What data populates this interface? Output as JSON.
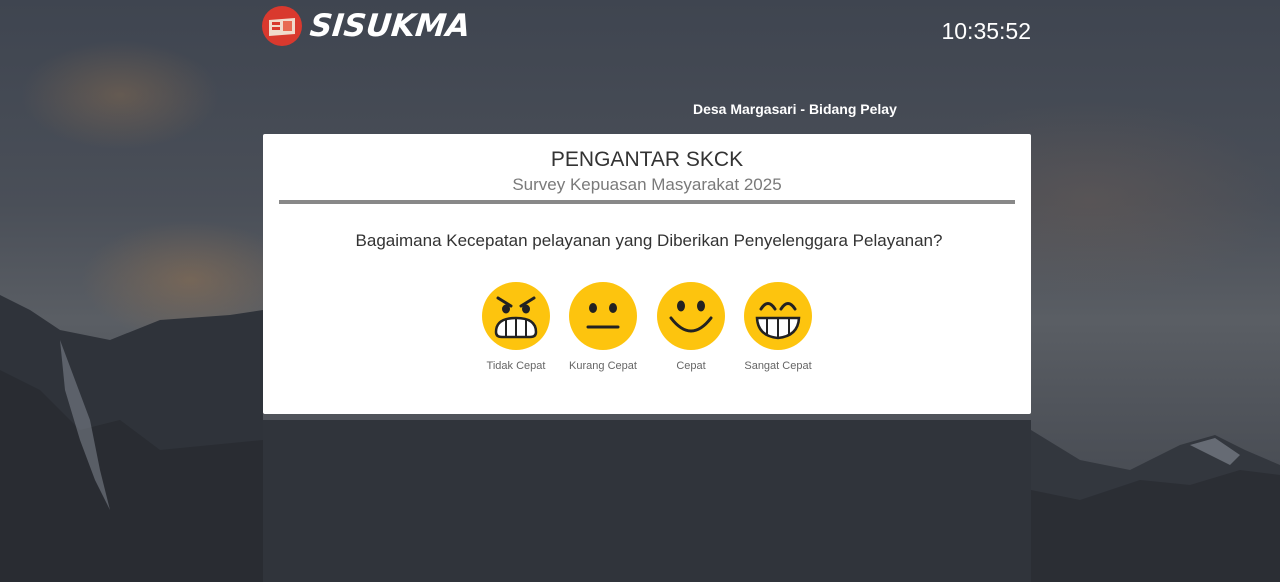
{
  "header": {
    "app_name": "SISUKMA",
    "clock": "10:35:52",
    "marquee": "Desa Margasari - Bidang Pelay"
  },
  "survey": {
    "title": "PENGANTAR SKCK",
    "subtitle": "Survey Kepuasan Masyarakat 2025",
    "question": "Bagaimana Kecepatan pelayanan yang Diberikan Penyelenggara Pelayanan?",
    "options": [
      {
        "label": "Tidak Cepat",
        "icon": "angry-face-icon"
      },
      {
        "label": "Kurang Cepat",
        "icon": "neutral-face-icon"
      },
      {
        "label": "Cepat",
        "icon": "smile-face-icon"
      },
      {
        "label": "Sangat Cepat",
        "icon": "grin-face-icon"
      }
    ]
  },
  "colors": {
    "logo_red": "#d9392e",
    "emoji_yellow": "#fdc40e",
    "card_bg": "#ffffff",
    "divider": "#888888"
  }
}
